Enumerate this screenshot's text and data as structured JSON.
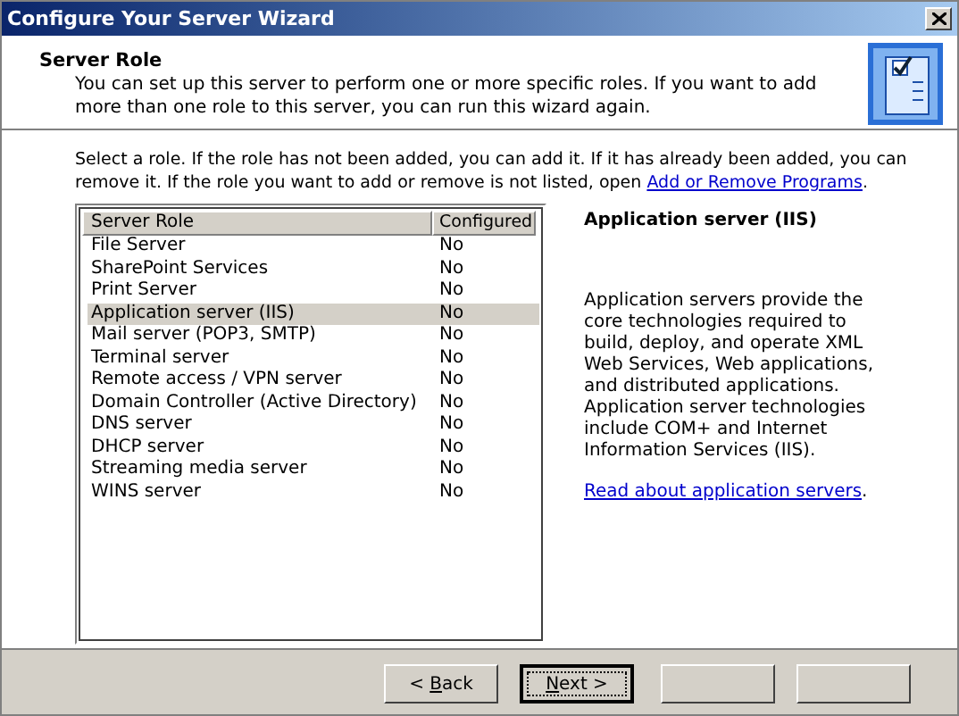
{
  "window": {
    "title": "Configure Your Server Wizard"
  },
  "header": {
    "title": "Server Role",
    "description": "You can set up this server to perform one or more specific roles. If you want to add more than one role to this server, you can run this wizard again."
  },
  "intro": {
    "text": "Select a role. If the role has not been added, you can add it. If it has already been added, you can remove it. If the role you want to add or remove is not listed, open ",
    "link": "Add or Remove Programs",
    "after": "."
  },
  "table": {
    "columns": [
      "Server Role",
      "Configured"
    ],
    "rows": [
      {
        "role": "File Server",
        "configured": "No",
        "selected": false
      },
      {
        "role": "SharePoint Services",
        "configured": "No",
        "selected": false
      },
      {
        "role": "Print Server",
        "configured": "No",
        "selected": false
      },
      {
        "role": "Application server (IIS)",
        "configured": "No",
        "selected": true
      },
      {
        "role": "Mail server (POP3, SMTP)",
        "configured": "No",
        "selected": false
      },
      {
        "role": "Terminal server",
        "configured": "No",
        "selected": false
      },
      {
        "role": "Remote access / VPN server",
        "configured": "No",
        "selected": false
      },
      {
        "role": "Domain Controller (Active Directory)",
        "configured": "No",
        "selected": false
      },
      {
        "role": "DNS server",
        "configured": "No",
        "selected": false
      },
      {
        "role": "DHCP server",
        "configured": "No",
        "selected": false
      },
      {
        "role": "Streaming media server",
        "configured": "No",
        "selected": false
      },
      {
        "role": "WINS server",
        "configured": "No",
        "selected": false
      }
    ]
  },
  "details": {
    "title": "Application server (IIS)",
    "description": "Application servers provide the core technologies required to build, deploy, and operate XML Web Services, Web applications, and distributed applications. Application server technologies include COM+ and Internet Information Services (IIS).",
    "link": "Read about application servers",
    "after": "."
  },
  "buttons": [
    {
      "before": "< ",
      "key": "B",
      "after": "ack",
      "focused": false
    },
    {
      "key": "N",
      "after": "ext >",
      "focused": true
    },
    {
      "focused": false
    },
    {
      "focused": false
    }
  ]
}
